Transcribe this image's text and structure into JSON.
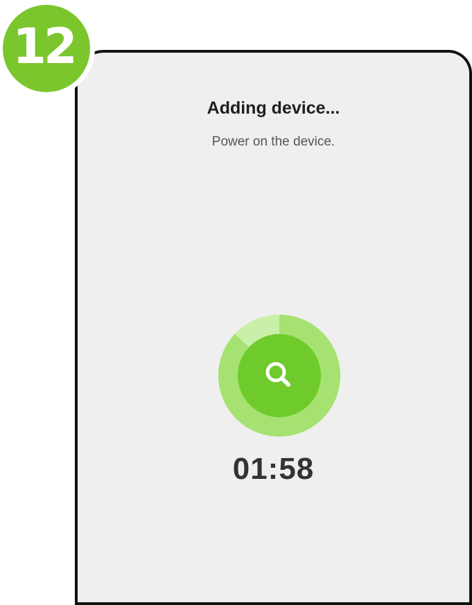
{
  "step": {
    "number": "12"
  },
  "screen": {
    "title": "Adding device...",
    "subtitle": "Power on the device.",
    "timer": "01:58",
    "progress_fraction": 0.87,
    "icon": "search-icon"
  },
  "colors": {
    "badge": "#7bc62d",
    "ring_light": "#c7f0a4",
    "ring_mid": "#a8e476",
    "center": "#6fcb2b",
    "background": "#efefef",
    "frame": "#111111"
  }
}
